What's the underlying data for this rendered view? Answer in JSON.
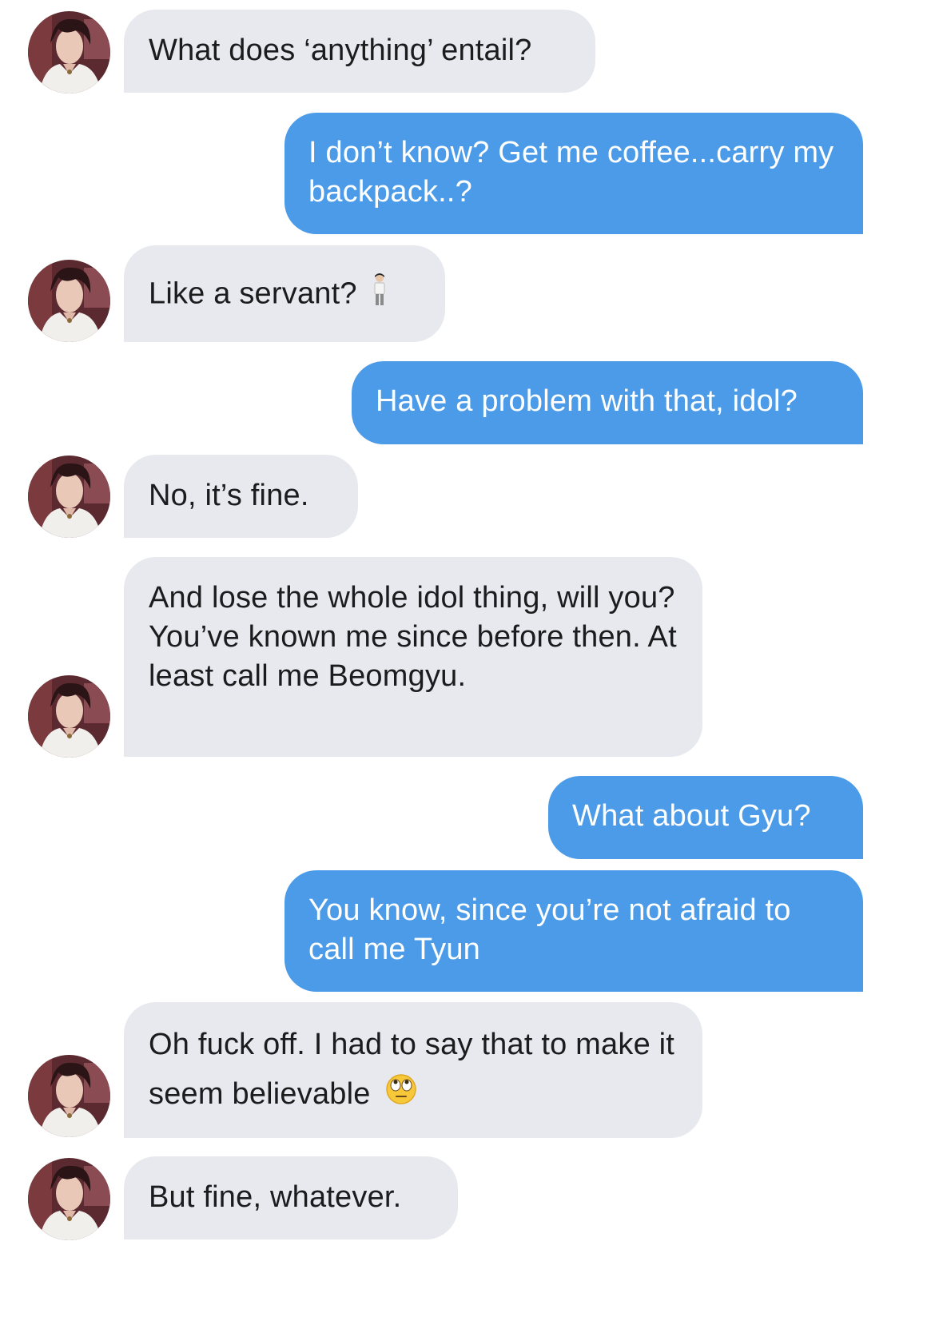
{
  "conversation": {
    "messages": [
      {
        "direction": "incoming",
        "text": "What does ‘anything’ entail?"
      },
      {
        "direction": "outgoing",
        "text": "I don’t know? Get me coffee...carry my backpack..?"
      },
      {
        "direction": "incoming",
        "text": "Like a servant?",
        "emoji": "person-standing-icon"
      },
      {
        "direction": "outgoing",
        "text": "Have a problem with that, idol?"
      },
      {
        "direction": "incoming",
        "text": "No, it’s fine."
      },
      {
        "direction": "incoming",
        "text": "And lose the whole idol thing, will you? You’ve known me since before then. At least call me Beomgyu."
      },
      {
        "direction": "outgoing",
        "text": "What about Gyu?"
      },
      {
        "direction": "outgoing",
        "text": "You know, since you’re not afraid to call me Tyun"
      },
      {
        "direction": "incoming",
        "text": "Oh fuck off. I had to say that to make it seem believable",
        "emoji": "eye-roll-face-icon"
      },
      {
        "direction": "incoming",
        "text": "But fine, whatever."
      }
    ]
  },
  "colors": {
    "incoming_bubble": "#e8e9ee",
    "outgoing_bubble": "#4c9be8",
    "incoming_text": "#1c1c1e",
    "outgoing_text": "#ffffff"
  }
}
